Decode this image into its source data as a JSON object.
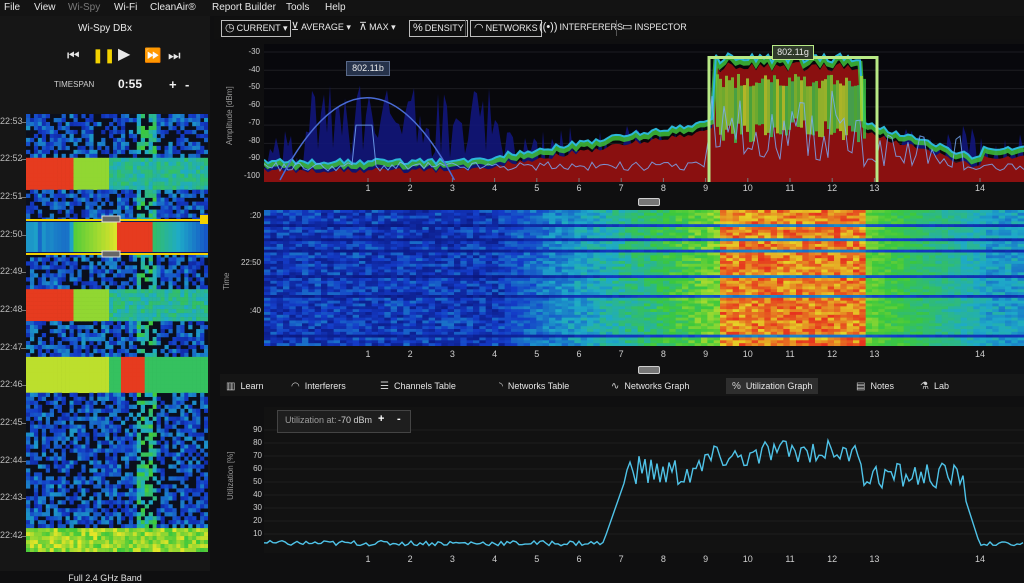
{
  "menu": [
    "File",
    "View",
    "Wi-Spy",
    "Wi-Fi",
    "CleanAir®",
    "Report Builder",
    "Tools",
    "Help"
  ],
  "device": {
    "name": "Wi-Spy DBx"
  },
  "timespan": {
    "label": "TIMESPAN",
    "value": "0:55"
  },
  "left_times": [
    "22:53",
    "22:52",
    "22:51",
    "22:50",
    "22:49",
    "22:48",
    "22:47",
    "22:46",
    "22:45",
    "22:44",
    "22:43",
    "22:42"
  ],
  "band_label": "Full 2.4 GHz Band",
  "toolbar": {
    "current": "CURRENT",
    "average": "AVERAGE",
    "max": "MAX",
    "density": "DENSITY",
    "networks": "NETWORKS",
    "interferers": "INTERFERERS",
    "inspector": "INSPECTOR"
  },
  "spectrum": {
    "ylabel": "Amplitude [dBm]",
    "yticks": [
      "-30",
      "-40",
      "-50",
      "-60",
      "-70",
      "-80",
      "-90",
      "-100"
    ],
    "overlay_b": "802.11b",
    "overlay_g": "802.11g"
  },
  "density": {
    "ylabel": "Time",
    "yticks": [
      ":20",
      "22:50",
      ":40"
    ]
  },
  "channels": [
    "1",
    "2",
    "3",
    "4",
    "5",
    "6",
    "7",
    "8",
    "9",
    "10",
    "11",
    "12",
    "13",
    "14"
  ],
  "tabs": [
    {
      "label": "Learn",
      "icon": "book-icon"
    },
    {
      "label": "Interferers",
      "icon": "signal-wave-icon"
    },
    {
      "label": "Channels Table",
      "icon": "table-list-icon"
    },
    {
      "label": "Networks Table",
      "icon": "wifi-icon"
    },
    {
      "label": "Networks Graph",
      "icon": "graph-curve-icon"
    },
    {
      "label": "Utilization Graph",
      "icon": "percent-icon"
    },
    {
      "label": "Notes",
      "icon": "notes-icon"
    },
    {
      "label": "Lab",
      "icon": "lab-icon"
    }
  ],
  "active_tab": "Utilization Graph",
  "utilization": {
    "ylabel": "Utilization [%]",
    "at_label": "Utilization at:",
    "at_value": "-70 dBm",
    "plus": "+",
    "minus": "-",
    "yticks": [
      "90",
      "80",
      "70",
      "60",
      "50",
      "40",
      "30",
      "20",
      "10"
    ]
  },
  "transport": {
    "plus": "+",
    "minus": "-"
  },
  "colors": {
    "accent_yellow": "#f3d200",
    "line_cyan": "#4fc3e8",
    "overlay_green": "#b8e986",
    "overlay_blue": "#4a6cd6"
  }
}
